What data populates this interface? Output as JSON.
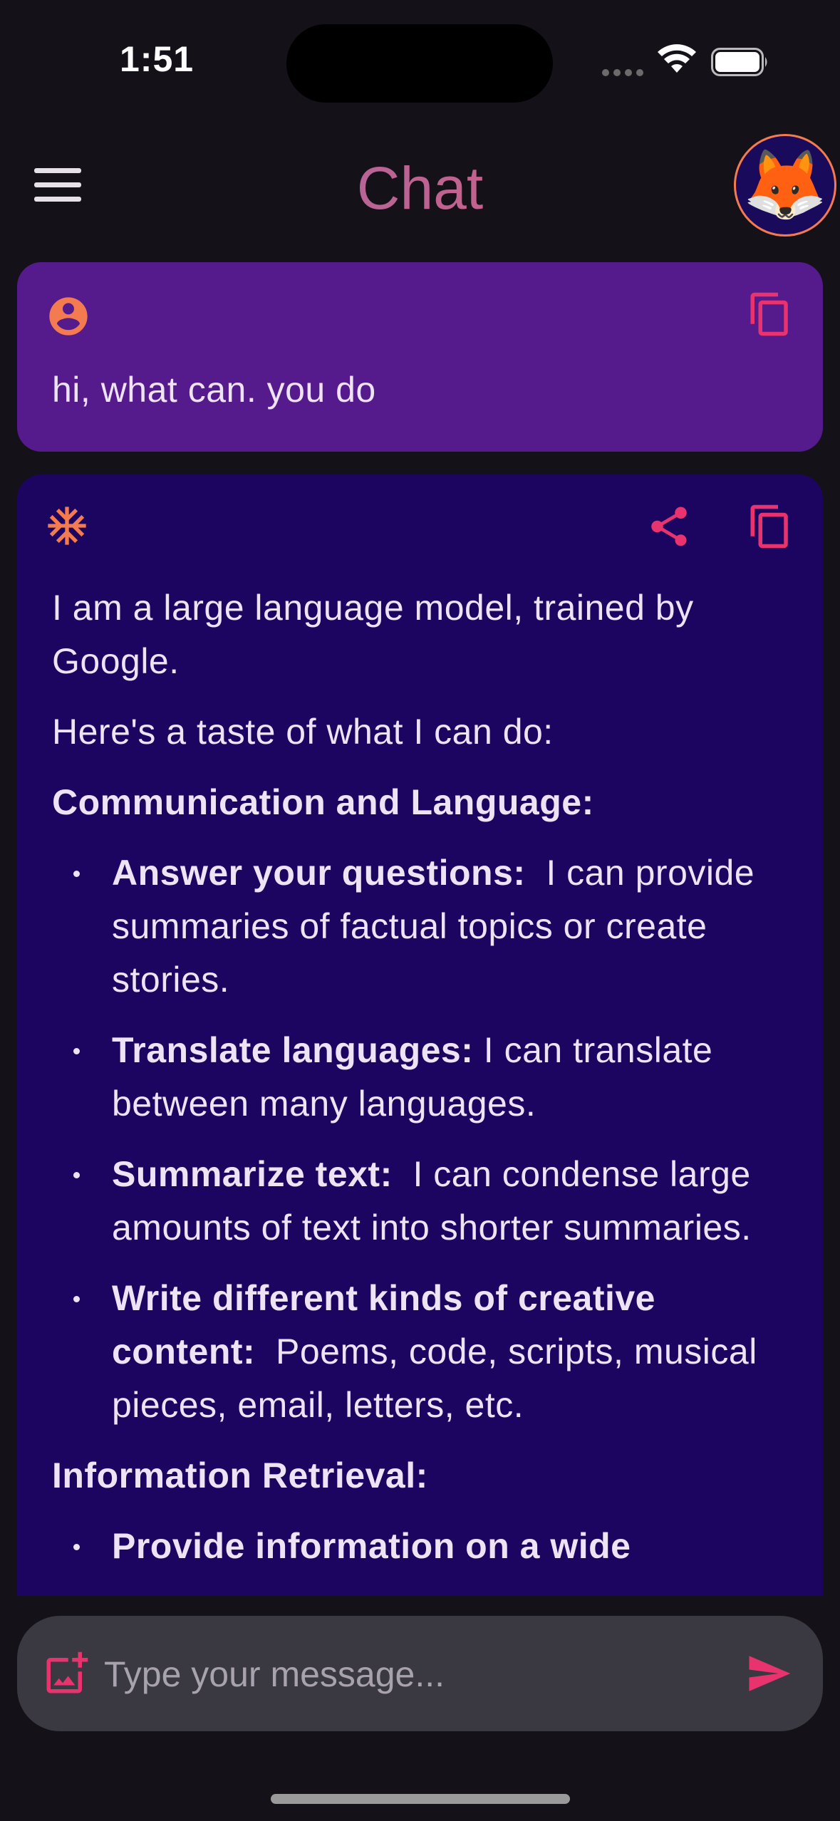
{
  "status": {
    "time": "1:51"
  },
  "app_bar": {
    "title": "Chat",
    "avatar_emoji": "🦊"
  },
  "messages": {
    "user": {
      "text": "hi, what can. you do",
      "icon": "account-circle-icon",
      "copy_icon": "copy-icon"
    },
    "model": {
      "icon": "snowflake-icon",
      "share_icon": "share-icon",
      "copy_icon": "copy-icon",
      "intro": "I am a large language model, trained by Google.",
      "taste": "Here's a taste of what I can do:",
      "section1_heading": "Communication and Language:",
      "section1_items": [
        {
          "title": "Answer your questions:",
          "text": "  I can provide summaries of factual topics or create stories."
        },
        {
          "title": "Translate languages:",
          "text": " I can translate between many languages."
        },
        {
          "title": "Summarize text:",
          "text": "  I can condense large amounts of text into shorter summaries."
        },
        {
          "title": "Write different kinds of creative content:",
          "text": "  Poems, code, scripts, musical pieces, email, letters, etc."
        }
      ],
      "section2_heading": "Information Retrieval:",
      "section2_items": [
        {
          "title": "Provide information on a wide",
          "text": ""
        }
      ]
    }
  },
  "composer": {
    "placeholder": "Type your message...",
    "attach_icon": "add-photo-icon",
    "send_icon": "send-icon"
  },
  "colors": {
    "background": "#141218",
    "user_bubble": "#551A8B",
    "model_bubble": "#1C0560",
    "accent_pink": "#E8336E",
    "accent_orange": "#F47B4F",
    "input_bg": "#3A3840"
  }
}
